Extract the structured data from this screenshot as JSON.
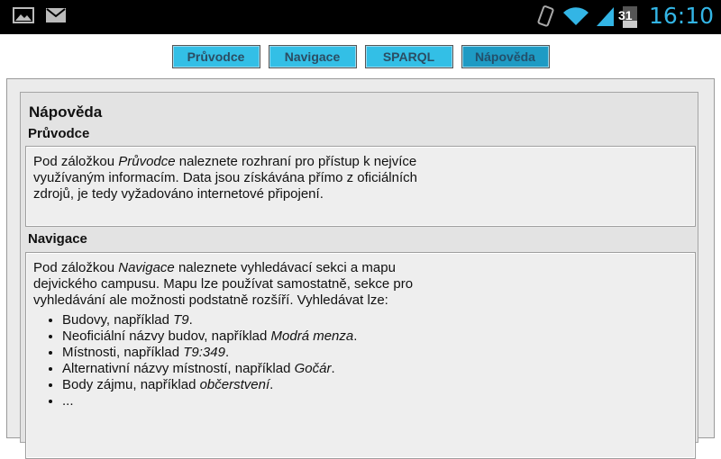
{
  "tabs": [
    {
      "label": "Průvodce"
    },
    {
      "label": "Navigace"
    },
    {
      "label": "SPARQL"
    },
    {
      "label": "Nápověda"
    }
  ],
  "status": {
    "time": "16:10",
    "battery": "31"
  },
  "title": "Nápověda",
  "pruvodce": {
    "heading": "Průvodce",
    "text_a": "Pod záložkou ",
    "text_em": "Průvodce",
    "text_b": " naleznete rozhraní pro přístup k nejvíce využívaným informacím. Data jsou získávána přímo z oficiálních zdrojů, je tedy vyžadováno internetové připojení."
  },
  "navigace": {
    "heading": "Navigace",
    "text_a": "Pod záložkou ",
    "text_em": "Navigace",
    "text_b": " naleznete vyhledávací sekci a mapu dejvického campusu. Mapu lze používat samostatně, sekce pro vyhledávání ale možnosti podstatně rozšíří. Vyhledávat lze:",
    "items": [
      {
        "text": "Budovy, například ",
        "em": "T9",
        "end": "."
      },
      {
        "text": "Neoficiální názvy budov, například ",
        "em": "Modrá menza",
        "end": "."
      },
      {
        "text": "Místnosti, například ",
        "em": "T9:349",
        "end": "."
      },
      {
        "text": "Alternativní názvy místností, například ",
        "em": "Gočár",
        "end": "."
      },
      {
        "text": "Body zájmu, například ",
        "em": "občerstvení",
        "end": "."
      },
      {
        "text": "...",
        "em": "",
        "end": ""
      }
    ]
  }
}
